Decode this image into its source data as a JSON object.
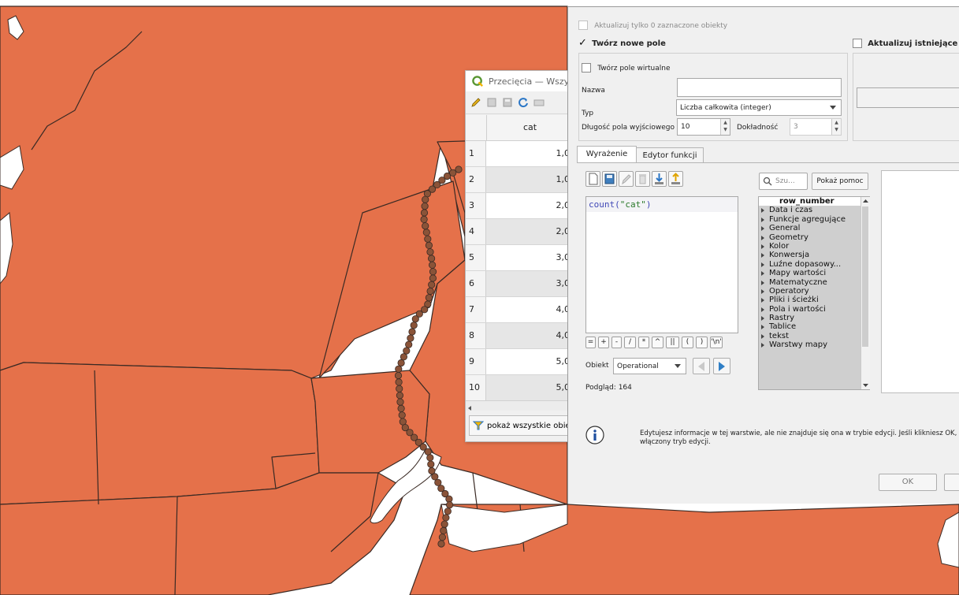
{
  "colors": {
    "map_fill": "#e5714a",
    "map_border": "#3a2a24",
    "point": "#8a5338",
    "water": "#ffffff",
    "accent": "#1e6fb6"
  },
  "attribute_table": {
    "title": "Przecięcia — Wszys",
    "column_header": "cat",
    "rows": [
      {
        "num": "1",
        "value": "1,0"
      },
      {
        "num": "2",
        "value": "1,0"
      },
      {
        "num": "3",
        "value": "2,0"
      },
      {
        "num": "4",
        "value": "2,0"
      },
      {
        "num": "5",
        "value": "3,0"
      },
      {
        "num": "6",
        "value": "3,0"
      },
      {
        "num": "7",
        "value": "4,0"
      },
      {
        "num": "8",
        "value": "4,0"
      },
      {
        "num": "9",
        "value": "5,0"
      },
      {
        "num": "10",
        "value": "5,0"
      }
    ],
    "filter_button": "pokaż wszystkie obiekty"
  },
  "field_calc": {
    "update_selected": "Aktualizuj tylko 0 zaznaczone obiekty",
    "create_new_field": "Twórz nowe pole",
    "update_existing": "Aktualizuj istniejące pole",
    "virtual_field": "Twórz pole wirtualne",
    "name_label": "Nazwa",
    "name_value": "",
    "type_label": "Typ",
    "type_value": "Liczba całkowita (integer)",
    "length_label": "Długość pola wyjściowego",
    "length_value": "10",
    "precision_label": "Dokładność",
    "precision_value": "3",
    "tab_expression": "Wyrażenie",
    "tab_function_editor": "Edytor funkcji",
    "expression_func": "count(",
    "expression_arg": "\"cat\"",
    "expression_close": ")",
    "operators": [
      "=",
      "+",
      "-",
      "/",
      "*",
      "^",
      "||",
      "(",
      ")",
      "'\\n'"
    ],
    "feature_label": "Obiekt",
    "feature_value": "Operational",
    "preview_label": "Podgląd:",
    "preview_value": "164",
    "search_placeholder": "Szu...",
    "show_help": "Pokaż pomoc",
    "functions": [
      "row_number",
      "Data i czas",
      "Funkcje agregujące",
      "General",
      "Geometry",
      "Kolor",
      "Konwersja",
      "Luźne dopasowy...",
      "Mapy wartości",
      "Matematyczne",
      "Operatory",
      "Pliki i ścieżki",
      "Pola i wartości",
      "Rastry",
      "Tablice",
      "tekst",
      "Warstwy mapy"
    ],
    "info_message": "Edytujesz informacje w tej warstwie, ale nie znajduje się ona w trybie edycji. Jeśli klikniesz OK, z",
    "info_message_2": "włączony tryb edycji.",
    "ok_label": "OK"
  }
}
